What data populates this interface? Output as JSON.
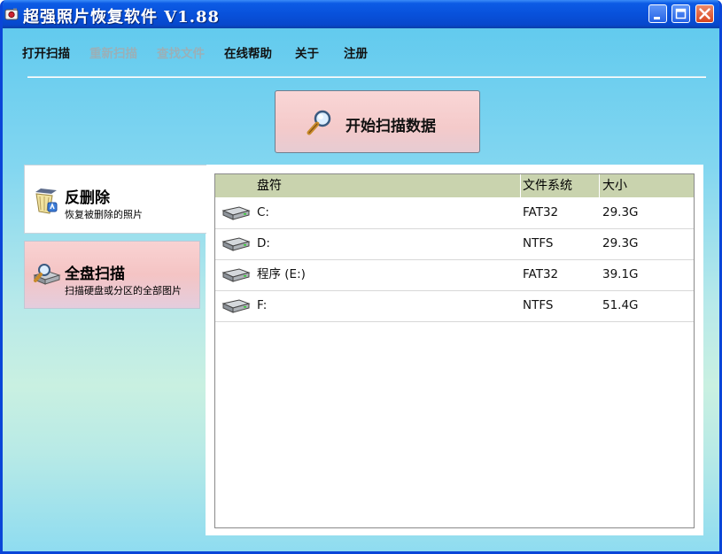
{
  "window": {
    "title": "超强照片恢复软件 V1.88"
  },
  "menu": [
    {
      "label": "打开扫描",
      "enabled": true
    },
    {
      "label": "重新扫描",
      "enabled": false
    },
    {
      "label": "查找文件",
      "enabled": false
    },
    {
      "label": "在线帮助",
      "enabled": true
    },
    {
      "label": "关于",
      "enabled": true
    },
    {
      "label": "注册",
      "enabled": true
    }
  ],
  "scan_button": {
    "label": "开始扫描数据",
    "icon": "magnifier-icon"
  },
  "modes": [
    {
      "title": "反删除",
      "subtitle": "恢复被删除的照片",
      "icon": "recycle-bin-icon",
      "selected": true
    },
    {
      "title": "全盘扫描",
      "subtitle": "扫描硬盘或分区的全部图片",
      "icon": "disk-scan-icon",
      "selected": false
    }
  ],
  "drive_table": {
    "columns": [
      "盘符",
      "文件系统",
      "大小"
    ],
    "rows": [
      {
        "drive": "C:",
        "fs": "FAT32",
        "size": "29.3G"
      },
      {
        "drive": "D:",
        "fs": "NTFS",
        "size": "29.3G"
      },
      {
        "drive": "程序 (E:)",
        "fs": "FAT32",
        "size": "39.1G"
      },
      {
        "drive": "F:",
        "fs": "NTFS",
        "size": "51.4G"
      }
    ]
  },
  "colors": {
    "titlebar": "#0851DB",
    "header_bg": "#C9D3AE",
    "scan_button_bg": "#F4CACA",
    "disabled_text": "#9AB0B8"
  }
}
